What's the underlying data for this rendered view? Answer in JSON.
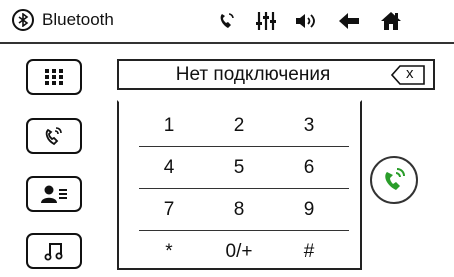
{
  "header": {
    "title": "Bluetooth",
    "icons": [
      "bluetooth-icon",
      "call-icon",
      "equalizer-icon",
      "volume-icon",
      "back-icon",
      "home-icon"
    ]
  },
  "sidebar": {
    "items": [
      {
        "name": "keypad",
        "icon": "dialpad-icon"
      },
      {
        "name": "recent-calls",
        "icon": "phone-ringing-icon"
      },
      {
        "name": "contacts",
        "icon": "contacts-icon"
      },
      {
        "name": "music",
        "icon": "music-note-icon"
      }
    ]
  },
  "display": {
    "status": "Нет подключения",
    "backspace_label": "x"
  },
  "keypad": {
    "rows": [
      [
        "1",
        "2",
        "3"
      ],
      [
        "4",
        "5",
        "6"
      ],
      [
        "7",
        "8",
        "9"
      ],
      [
        "*",
        "0/+",
        "#"
      ]
    ]
  },
  "call": {
    "icon": "call-answer-icon",
    "accent": "#2a9d2a"
  }
}
